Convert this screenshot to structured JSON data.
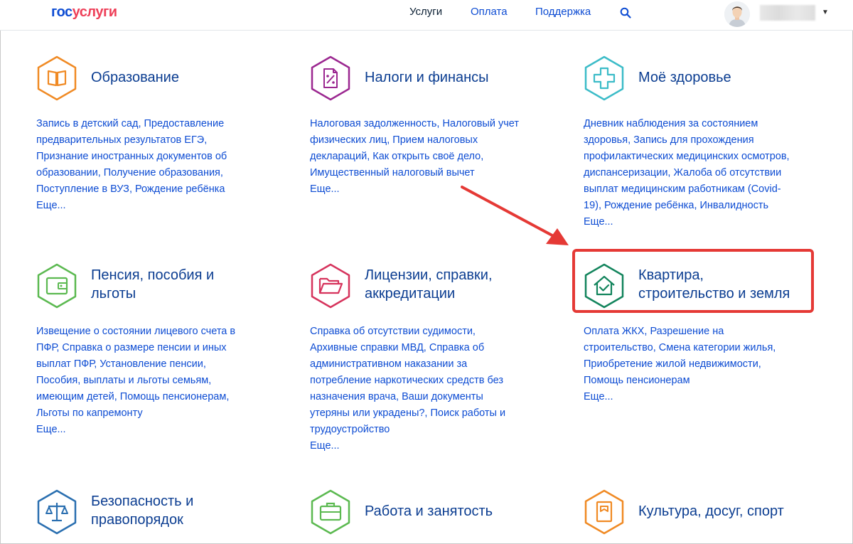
{
  "header": {
    "logo_left": "гос",
    "logo_right": "услуги",
    "nav": {
      "services": "Услуги",
      "payment": "Оплата",
      "support": "Поддержка"
    }
  },
  "categories": [
    {
      "title": "Образование",
      "desc": [
        "Запись в детский сад, Предоставление",
        "предварительных результатов ЕГЭ,",
        "Признание иностранных документов об",
        "образовании, Получение образования,",
        "Поступление в ВУЗ, Рождение ребёнка"
      ],
      "more": "Еще..."
    },
    {
      "title": "Налоги и финансы",
      "desc": [
        "Налоговая задолженность, Налоговый учет",
        "физических лиц, Прием налоговых",
        "деклараций, Как открыть своё дело,",
        "Имущественный налоговый вычет"
      ],
      "more": "Еще..."
    },
    {
      "title": "Моё здоровье",
      "desc": [
        "Дневник наблюдения за состоянием",
        "здоровья, Запись для прохождения",
        "профилактических медицинских осмотров,",
        "диспансеризации, Жалоба об отсутствии",
        "выплат медицинским работникам (Covid-",
        "19), Рождение ребёнка, Инвалидность"
      ],
      "more": "Еще..."
    },
    {
      "title_line1": "Пенсия, пособия и",
      "title_line2": "льготы",
      "desc": [
        "Извещение о состоянии лицевого счета в",
        "ПФР, Справка о размере пенсии и иных",
        "выплат ПФР, Установление пенсии,",
        "Пособия, выплаты и льготы семьям,",
        "имеющим детей, Помощь пенсионерам,",
        "Льготы по капремонту"
      ],
      "more": "Еще..."
    },
    {
      "title_line1": "Лицензии, справки,",
      "title_line2": "аккредитации",
      "desc": [
        "Справка об отсутствии судимости,",
        "Архивные справки МВД, Справка об",
        "административном наказании за",
        "потребление наркотических средств без",
        "назначения врача, Ваши документы",
        "утеряны или украдены?, Поиск работы и",
        "трудоустройство"
      ],
      "more": "Еще..."
    },
    {
      "title_line1": "Квартира,",
      "title_line2": "строительство и земля",
      "desc": [
        "Оплата ЖКХ, Разрешение на",
        "строительство, Смена категории жилья,",
        "Приобретение жилой недвижимости,",
        "Помощь пенсионерам"
      ],
      "more": "Еще..."
    },
    {
      "title_line1": "Безопасность и",
      "title_line2": "правопорядок"
    },
    {
      "title": "Работа и занятость"
    },
    {
      "title": "Культура, досуг, спорт"
    }
  ],
  "colors": {
    "education": "#f08a24",
    "taxes": "#9b2790",
    "health": "#3cbcc8",
    "pension": "#5bb950",
    "licenses": "#d6335c",
    "housing": "#12845c",
    "security": "#2a6fb0",
    "work": "#5bb950",
    "culture": "#f08a24",
    "highlight": "#e53935"
  }
}
